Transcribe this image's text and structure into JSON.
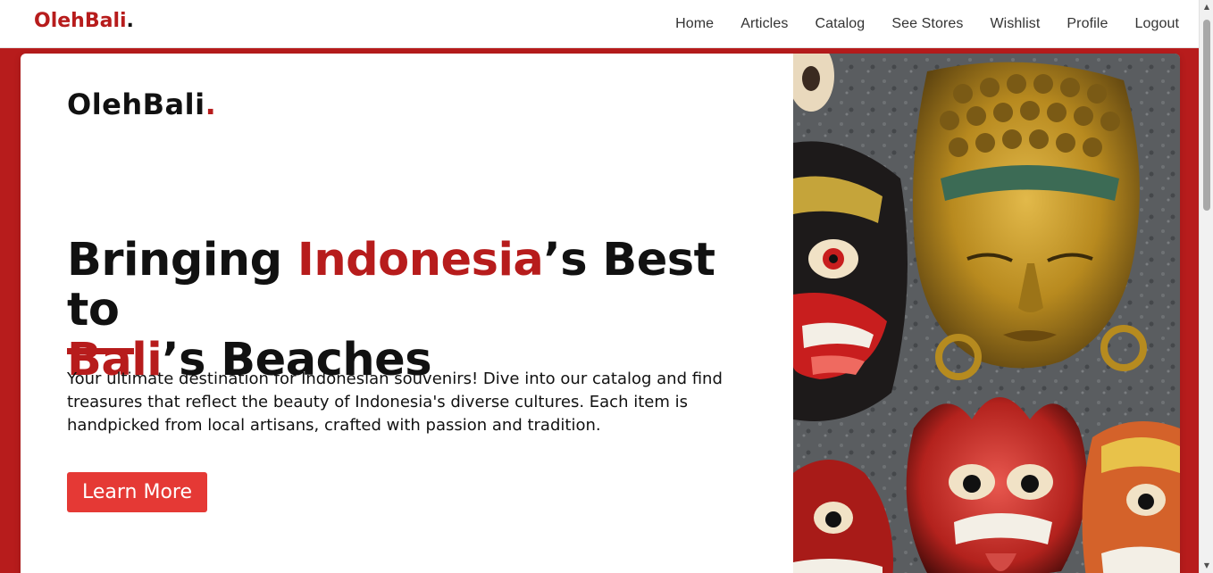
{
  "navbar": {
    "brand_name": "OlehBali",
    "brand_dot": ".",
    "links": [
      {
        "label": "Home"
      },
      {
        "label": "Articles"
      },
      {
        "label": "Catalog"
      },
      {
        "label": "See Stores"
      },
      {
        "label": "Wishlist"
      },
      {
        "label": "Profile"
      },
      {
        "label": "Logout"
      }
    ]
  },
  "hero": {
    "logo_name": "OlehBali",
    "logo_dot": ".",
    "title_part1": "Bringing ",
    "title_accent1": "Indonesia",
    "title_part2": "’s Best to",
    "title_accent2": "Bali",
    "title_part3": "’s Beaches",
    "description": "Your ultimate destination for Indonesian souvenirs! Dive into our catalog and find treasures that reflect the beauty of Indonesia's diverse cultures. Each item is handpicked from local artisans, crafted with passion and tradition.",
    "button_label": "Learn More",
    "image_subject": "balinese-masks-image"
  },
  "colors": {
    "brand_red": "#b71c1c",
    "button_red": "#e53935",
    "text_dark": "#111111"
  }
}
